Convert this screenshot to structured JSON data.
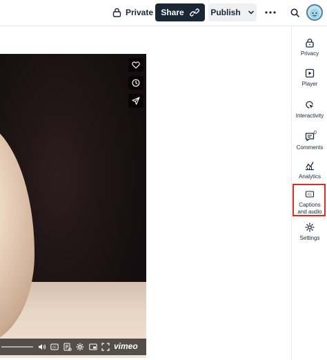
{
  "header": {
    "private_label": "Private",
    "share_label": "Share",
    "publish_label": "Publish",
    "more_icon": "more-horizontal-icon",
    "search_icon": "search-icon",
    "avatar_icon": "user-avatar"
  },
  "video": {
    "overlay_buttons": [
      "heart-icon",
      "clock-icon",
      "send-icon"
    ],
    "logo": "vimeo"
  },
  "sidebar": {
    "items": [
      {
        "label": "Privacy",
        "icon": "lock-icon"
      },
      {
        "label": "Player",
        "icon": "play-icon"
      },
      {
        "label": "Interactivity",
        "icon": "cursor-icon"
      },
      {
        "label": "Comments",
        "icon": "comment-icon",
        "count": "0"
      },
      {
        "label": "Analytics",
        "icon": "analytics-icon"
      },
      {
        "label": "Captions and audio",
        "icon": "captions-icon"
      },
      {
        "label": "Settings",
        "icon": "gear-icon"
      }
    ]
  },
  "colors": {
    "primary_dark": "#1a2735",
    "highlight": "#e0281f"
  }
}
